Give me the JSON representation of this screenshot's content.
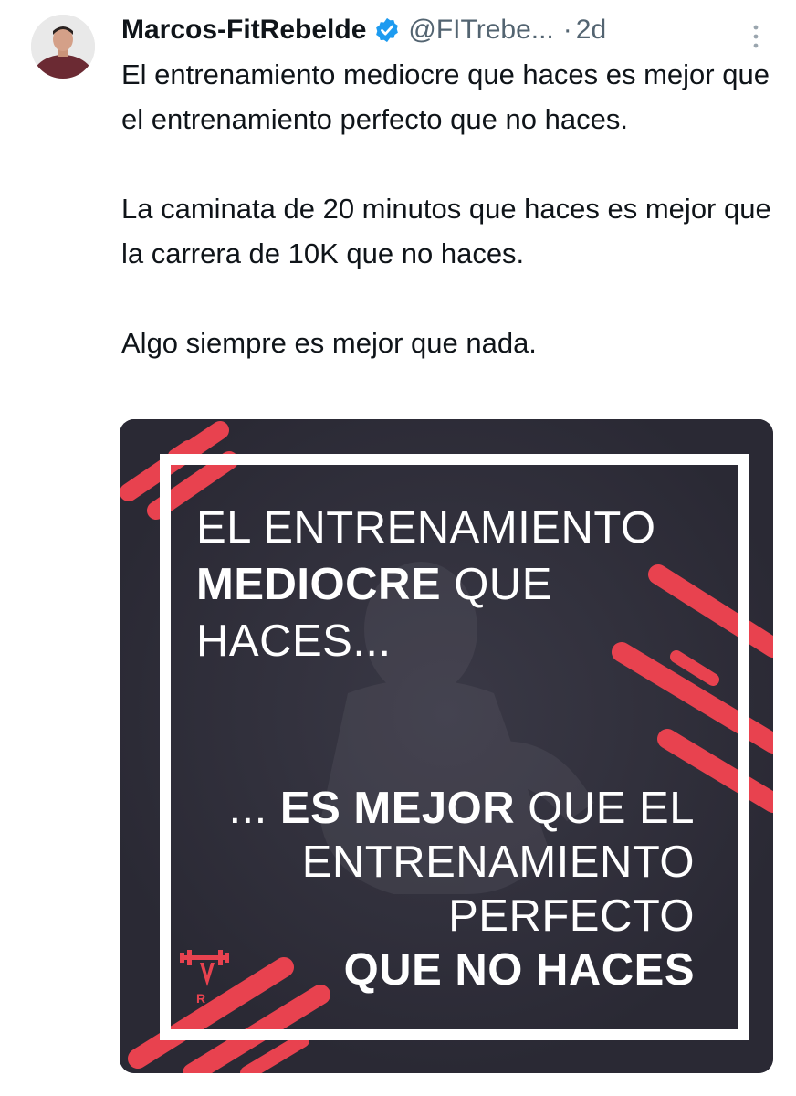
{
  "author": {
    "display_name": "Marcos-FitRebelde",
    "handle": "@FITrebe...",
    "separator": "·",
    "timestamp": "2d",
    "verified": true,
    "avatar_icon": "profile-photo"
  },
  "tweet": {
    "paragraphs": [
      "El entrenamiento mediocre que haces es mejor que el entrenamiento perfecto que no haces.",
      "La caminata de 20 minutos que haces es mejor que la carrera de 10K que no haces.",
      "Algo siempre es mejor que nada."
    ]
  },
  "image": {
    "top_line1": "EL ENTRENAMIENTO",
    "top_line2_bold": "MEDIOCRE",
    "top_line2_rest": " QUE",
    "top_line3": "HACES...",
    "bottom_line1_prefix": "... ",
    "bottom_line1_bold": "ES MEJOR",
    "bottom_line1_rest": " QUE EL",
    "bottom_line2": "ENTRENAMIENTO",
    "bottom_line3": "PERFECTO",
    "bottom_line4_bold": "QUE NO HACES",
    "colors": {
      "background": "#2b2a36",
      "accent": "#e8424f",
      "frame": "#ffffff"
    }
  },
  "icons": {
    "verified": "verified-badge-icon",
    "more": "more-options-icon",
    "logo": "fitrebelde-logo"
  }
}
